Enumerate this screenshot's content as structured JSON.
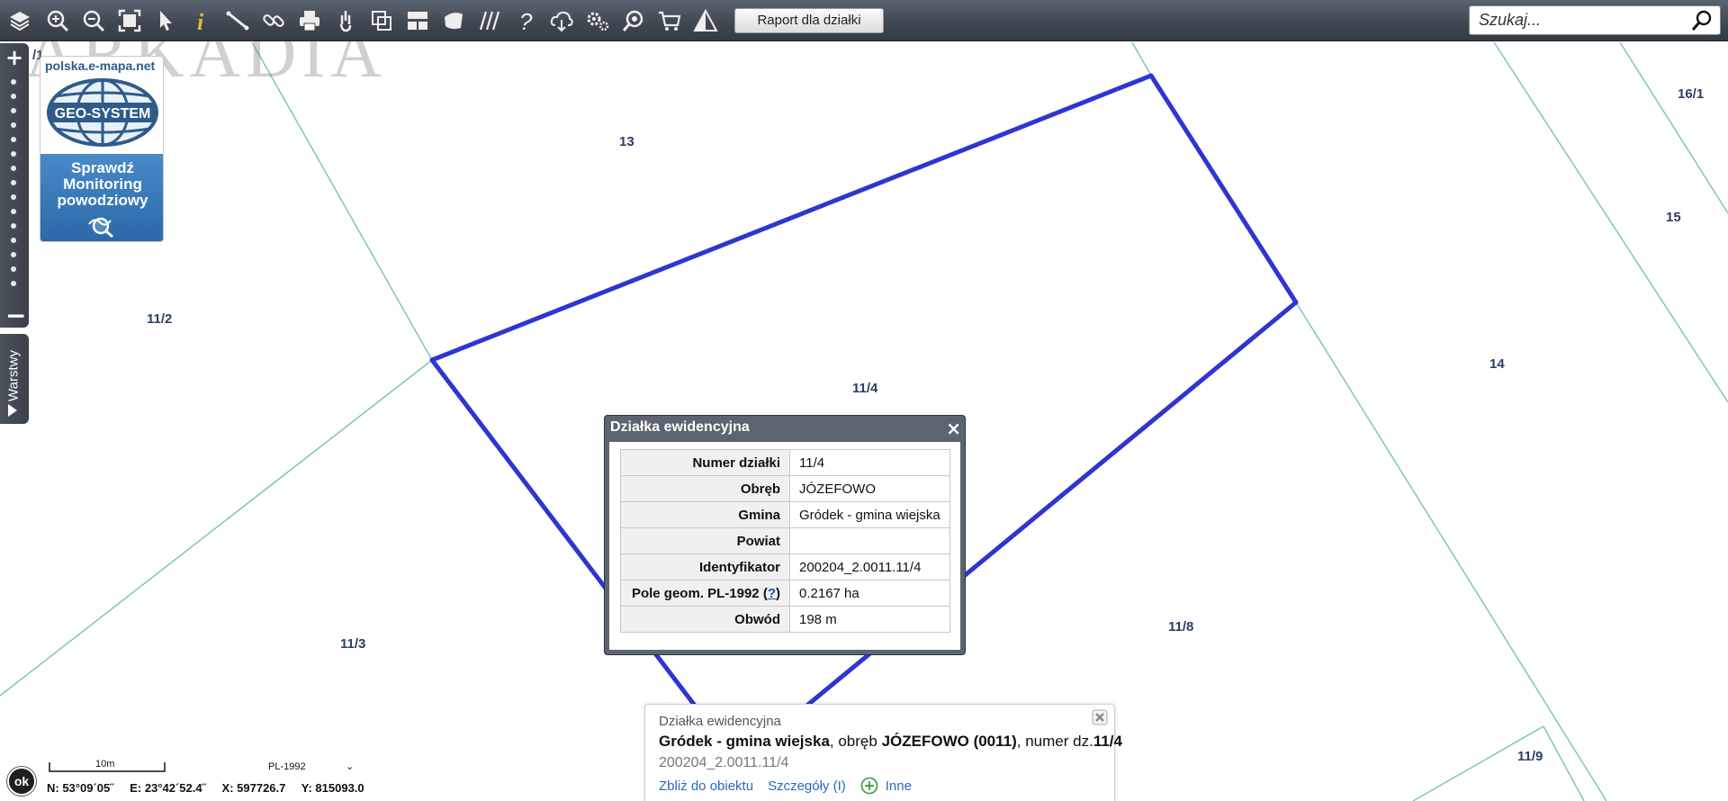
{
  "toolbar": {
    "tools": [
      "layers-icon",
      "zoom-in-icon",
      "zoom-out-icon",
      "full-extent-icon",
      "select-pointer-icon",
      "info-icon",
      "measure-icon",
      "link-icon",
      "print-icon",
      "pan-hand-icon",
      "copy-icon",
      "layout-icon",
      "polygon-icon",
      "hatch-icon",
      "help-icon",
      "cloud-download-icon",
      "settings-icon",
      "find-location-icon",
      "cart-icon",
      "warning-icon"
    ],
    "report_label": "Raport dla działki",
    "search_placeholder": "Szukaj..."
  },
  "watermark": "ARKADIA",
  "ad": {
    "site": "polska.e-mapa.net",
    "logo_text": "GEO-SYSTEM",
    "lines": [
      "Sprawdź",
      "Monitoring",
      "powodziowy"
    ]
  },
  "sidebar": {
    "layers_label": "Warstwy"
  },
  "map": {
    "colors": {
      "parcel_line": "#7fc4bc",
      "highlight": "#2f35d0"
    },
    "labels": [
      {
        "id": "l_11_1_partial",
        "text": "/1"
      },
      {
        "id": "l_13",
        "text": "13"
      },
      {
        "id": "l_16_1",
        "text": "16/1"
      },
      {
        "id": "l_15",
        "text": "15"
      },
      {
        "id": "l_11_2",
        "text": "11/2"
      },
      {
        "id": "l_14",
        "text": "14"
      },
      {
        "id": "l_11_4",
        "text": "11/4"
      },
      {
        "id": "l_11_8",
        "text": "11/8"
      },
      {
        "id": "l_11_3",
        "text": "11/3"
      },
      {
        "id": "l_11_9",
        "text": "11/9"
      }
    ]
  },
  "popup": {
    "title": "Działka ewidencyjna",
    "rows": [
      {
        "key": "Numer działki",
        "value": "11/4"
      },
      {
        "key": "Obręb",
        "value": "JÓZEFOWO"
      },
      {
        "key": "Gmina",
        "value": "Gródek - gmina wiejska"
      },
      {
        "key": "Powiat",
        "value": ""
      },
      {
        "key": "Identyfikator",
        "value": "200204_2.0011.11/4"
      },
      {
        "key": "Pole geom. PL-1992",
        "value": "0.2167 ha"
      },
      {
        "key": "Obwód",
        "value": "198 m"
      }
    ],
    "help_link": "?"
  },
  "info_card": {
    "type": "Działka ewidencyjna",
    "gmina": "Gródek - gmina wiejska",
    "obreb_prefix": ", obręb ",
    "obreb": "JÓZEFOWO (0011)",
    "numer_prefix": ", numer dz.",
    "numer": "11/4",
    "identifier": "200204_2.0011.11/4",
    "links": {
      "zoom": "Zbliż do obiektu",
      "details": "Szczegóły (I)",
      "other": "Inne"
    }
  },
  "status": {
    "ok_label": "ok",
    "scale": "10m",
    "crs": "PL-1992",
    "coords": {
      "n": "N: 53°09´05˝",
      "e": "E: 23°42´52.4˝",
      "x": "X: 597726.7",
      "y": "Y: 815093.0"
    }
  }
}
